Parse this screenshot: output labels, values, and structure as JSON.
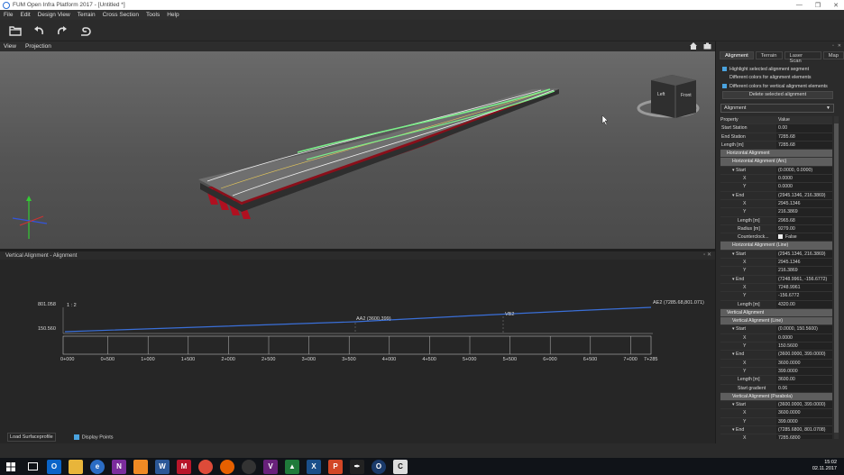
{
  "window": {
    "title": "FUM Open Infra Platform 2017 - [Untitled *]",
    "minimize": "—",
    "restore": "❐",
    "close": "✕"
  },
  "menu": [
    "File",
    "Edit",
    "Design View",
    "Terrain",
    "Cross Section",
    "Tools",
    "Help"
  ],
  "viewbar": {
    "view": "View",
    "projection": "Projection"
  },
  "viewcube": {
    "left": "Left",
    "front": "Front"
  },
  "vertical_panel": {
    "title": "Vertical Alignment - Alignment",
    "elevation_max": "801.058",
    "elevation_min": "150.560",
    "scale": "1 : 2",
    "labels": {
      "aa2": "AA2 (3600,399)",
      "vb2": "VB2",
      "ae2": "AE2 (7285.68,801.071)"
    },
    "stations": [
      "0+000",
      "0+500",
      "1+000",
      "1+500",
      "2+000",
      "2+500",
      "3+000",
      "3+500",
      "4+000",
      "4+500",
      "5+000",
      "5+500",
      "6+000",
      "6+500",
      "7+000",
      "7+285"
    ],
    "load_button": "Load Surfaceprofile",
    "display_points": "Display Points"
  },
  "right_panel": {
    "tabs": [
      "Alignment",
      "Terrain",
      "Laser Scan",
      "Map"
    ],
    "options": {
      "highlight": "Highlight selected alignment segment",
      "diff_colors": "Different colors for alignment elements",
      "diff_vertical": "Different colors for vertical alignment elements"
    },
    "delete_button": "Delete selected alignment",
    "selector": "Alignment",
    "header": {
      "property": "Property",
      "value": "Value"
    },
    "rows": [
      {
        "type": "kv",
        "indent": 0,
        "name": "Start Station",
        "value": "0.00"
      },
      {
        "type": "kv",
        "indent": 0,
        "name": "End Station",
        "value": "7285.68"
      },
      {
        "type": "kv",
        "indent": 0,
        "name": "Length [m]",
        "value": "7285.68"
      },
      {
        "type": "sec",
        "indent": 1,
        "name": "Horizontal Alignment"
      },
      {
        "type": "sec",
        "indent": 2,
        "name": "Horizontal Alignment (Arc)"
      },
      {
        "type": "kv",
        "indent": 2,
        "name": "▾ Start",
        "value": "(0.0000, 0.0000)"
      },
      {
        "type": "kv",
        "indent": 4,
        "name": "X",
        "value": "0.0000"
      },
      {
        "type": "kv",
        "indent": 4,
        "name": "Y",
        "value": "0.0000"
      },
      {
        "type": "kv",
        "indent": 2,
        "name": "▾ End",
        "value": "(2945.1346, 216.3869)"
      },
      {
        "type": "kv",
        "indent": 4,
        "name": "X",
        "value": "2945.1346"
      },
      {
        "type": "kv",
        "indent": 4,
        "name": "Y",
        "value": "216.3869"
      },
      {
        "type": "kv",
        "indent": 3,
        "name": "Length [m]",
        "value": "2965.68"
      },
      {
        "type": "kv",
        "indent": 3,
        "name": "Radius [m]",
        "value": "9279.00"
      },
      {
        "type": "chk",
        "indent": 3,
        "name": "Counterclock...",
        "value": "False"
      },
      {
        "type": "sec",
        "indent": 2,
        "name": "Horizontal Alignment (Line)"
      },
      {
        "type": "kv",
        "indent": 2,
        "name": "▾ Start",
        "value": "(2945.1346, 216.3869)"
      },
      {
        "type": "kv",
        "indent": 4,
        "name": "X",
        "value": "2945.1346"
      },
      {
        "type": "kv",
        "indent": 4,
        "name": "Y",
        "value": "216.3869"
      },
      {
        "type": "kv",
        "indent": 2,
        "name": "▾ End",
        "value": "(7248.9961, -156.6772)"
      },
      {
        "type": "kv",
        "indent": 4,
        "name": "X",
        "value": "7248.9961"
      },
      {
        "type": "kv",
        "indent": 4,
        "name": "Y",
        "value": "-156.6772"
      },
      {
        "type": "kv",
        "indent": 3,
        "name": "Length [m]",
        "value": "4320.00"
      },
      {
        "type": "sec",
        "indent": 1,
        "name": "Vertical Alignment"
      },
      {
        "type": "sec",
        "indent": 2,
        "name": "Vertical Alignment (Line)"
      },
      {
        "type": "kv",
        "indent": 2,
        "name": "▾ Start",
        "value": "(0.0000, 150.5600)"
      },
      {
        "type": "kv",
        "indent": 4,
        "name": "X",
        "value": "0.0000"
      },
      {
        "type": "kv",
        "indent": 4,
        "name": "Y",
        "value": "150.5600"
      },
      {
        "type": "kv",
        "indent": 2,
        "name": "▾ End",
        "value": "(3600.0000, 399.0000)"
      },
      {
        "type": "kv",
        "indent": 4,
        "name": "X",
        "value": "3600.0000"
      },
      {
        "type": "kv",
        "indent": 4,
        "name": "Y",
        "value": "399.0000"
      },
      {
        "type": "kv",
        "indent": 3,
        "name": "Length [m]",
        "value": "3600.00"
      },
      {
        "type": "kv",
        "indent": 3,
        "name": "Start gradient",
        "value": "0.06"
      },
      {
        "type": "sec",
        "indent": 2,
        "name": "Vertical Alignment (Parabola)"
      },
      {
        "type": "kv",
        "indent": 2,
        "name": "▾ Start",
        "value": "(3600.0000, 399.0000)"
      },
      {
        "type": "kv",
        "indent": 4,
        "name": "X",
        "value": "3600.0000"
      },
      {
        "type": "kv",
        "indent": 4,
        "name": "Y",
        "value": "399.0000"
      },
      {
        "type": "kv",
        "indent": 2,
        "name": "▾ End",
        "value": "(7285.6800, 801.0708)"
      },
      {
        "type": "kv",
        "indent": 4,
        "name": "X",
        "value": "7285.6800"
      }
    ]
  },
  "taskbar": {
    "time": "15:02",
    "date": "02.11.2017"
  },
  "colors": {
    "accent": "#4aa3df",
    "road_edge": "#b01020",
    "alignment_line": "#3a6fd8",
    "highlight_green": "#7cf08a"
  }
}
